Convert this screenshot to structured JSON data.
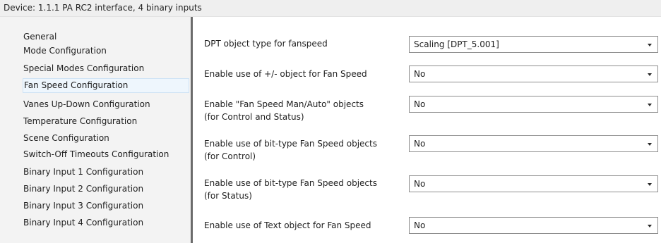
{
  "device_title": "Device: 1.1.1  PA RC2 interface, 4 binary inputs",
  "sidebar": {
    "items": [
      {
        "label": "General"
      },
      {
        "label": "Mode Configuration"
      },
      {
        "label": "Special Modes Configuration"
      },
      {
        "label": "Fan Speed Configuration",
        "selected": true
      },
      {
        "label": "Vanes Up-Down Configuration"
      },
      {
        "label": "Temperature Configuration"
      },
      {
        "label": "Scene Configuration"
      },
      {
        "label": "Switch-Off Timeouts Configuration"
      },
      {
        "label": "Binary Input 1 Configuration"
      },
      {
        "label": "Binary Input 2 Configuration"
      },
      {
        "label": "Binary Input 3 Configuration"
      },
      {
        "label": "Binary Input 4 Configuration"
      }
    ]
  },
  "params": [
    {
      "label1": "DPT object type for fanspeed",
      "label2": "",
      "value": "Scaling [DPT_5.001]"
    },
    {
      "label1": "Enable use of +/- object for Fan Speed",
      "label2": "",
      "value": "No"
    },
    {
      "label1": "Enable \"Fan Speed Man/Auto\" objects",
      "label2": "(for Control and Status)",
      "value": "No"
    },
    {
      "label1": "Enable use of bit-type Fan Speed objects",
      "label2": "(for Control)",
      "value": "No"
    },
    {
      "label1": "Enable use of bit-type Fan Speed objects",
      "label2": "(for Status)",
      "value": "No"
    },
    {
      "label1": "Enable use of Text object for Fan Speed",
      "label2": "",
      "value": "No"
    }
  ]
}
